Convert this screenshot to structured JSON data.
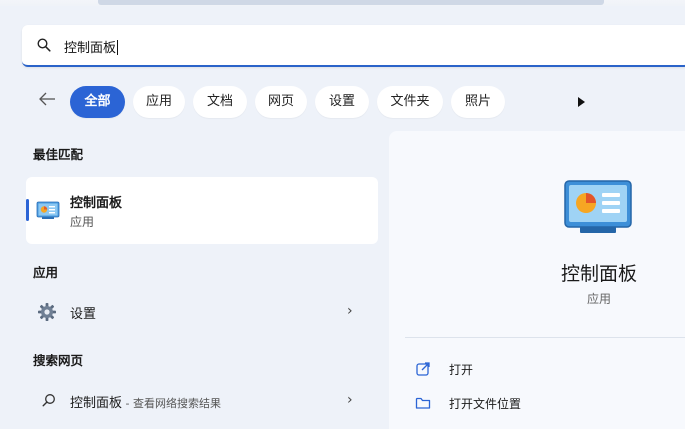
{
  "search": {
    "query": "控制面板"
  },
  "filters": {
    "tabs": [
      {
        "label": "全部",
        "active": true
      },
      {
        "label": "应用"
      },
      {
        "label": "文档"
      },
      {
        "label": "网页"
      },
      {
        "label": "设置"
      },
      {
        "label": "文件夹"
      },
      {
        "label": "照片"
      }
    ]
  },
  "left": {
    "best_match_heading": "最佳匹配",
    "best_match": {
      "title": "控制面板",
      "subtitle": "应用"
    },
    "apps_heading": "应用",
    "apps": [
      {
        "label": "设置"
      }
    ],
    "web_heading": "搜索网页",
    "web": [
      {
        "label": "控制面板",
        "hint": " - 查看网络搜索结果"
      }
    ]
  },
  "detail": {
    "title": "控制面板",
    "subtitle": "应用",
    "actions": [
      {
        "label": "打开",
        "icon": "open-external-icon"
      },
      {
        "label": "打开文件位置",
        "icon": "folder-icon"
      }
    ]
  },
  "colors": {
    "accent": "#2b64d5",
    "panel": "#eef2f9"
  }
}
